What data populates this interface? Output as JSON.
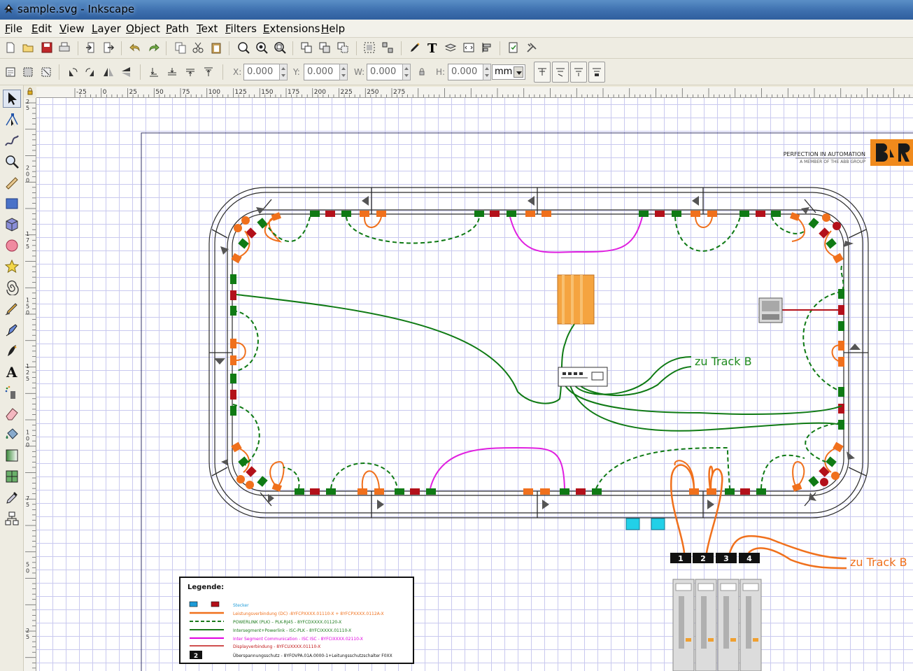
{
  "window": {
    "title": "sample.svg - Inkscape"
  },
  "menu": [
    "File",
    "Edit",
    "View",
    "Layer",
    "Object",
    "Path",
    "Text",
    "Filters",
    "Extensions",
    "Help"
  ],
  "controls": {
    "x_label": "X:",
    "x_value": "0.000",
    "y_label": "Y:",
    "y_value": "0.000",
    "w_label": "W:",
    "w_value": "0.000",
    "h_label": "H:",
    "h_value": "0.000",
    "unit": "mm"
  },
  "ruler": {
    "horizontal_ticks": [
      "-25",
      "0",
      "25",
      "50",
      "75",
      "100",
      "125",
      "150",
      "175",
      "200",
      "225",
      "250",
      "275"
    ],
    "vertical_ticks": [
      "25",
      "200",
      "175",
      "150",
      "125",
      "100",
      "75",
      "50",
      "25"
    ]
  },
  "drawing": {
    "logo_tagline": "PERFECTION IN AUTOMATION",
    "logo_subline": "A MEMBER OF THE ABB GROUP",
    "track_b_label_green": "zu Track B",
    "track_b_label_orange": "zu Track B",
    "connector_numbers": [
      "1",
      "2",
      "3",
      "4"
    ],
    "legend": {
      "title": "Legende:",
      "items": [
        {
          "label": "Stecker",
          "color": "#1e9bd7"
        },
        {
          "label": "Leistungsverbindung (DC) -8YFCPXXXX.01110-X + 8YFCPXXXX.0112A-X",
          "color": "#f07d1c"
        },
        {
          "label": "POWERLINK (PLK) – PLK-RJ45 - 8YFCDXXXX.01120-X",
          "color": "#1b7a1b"
        },
        {
          "label": "Intersegment+Powerlink - ISC-PLK - 8YFCIXXXX.01110-X",
          "color": "#1b7a1b"
        },
        {
          "label": "Inter Segment Communication - ISC ISC - 8YFCIXXXX.02110-X",
          "color": "#e000e0"
        },
        {
          "label": "Displayverbindung - 8YFCUXXXX.01110-X",
          "color": "#c01515"
        },
        {
          "label": "Überspannungsschutz - 8YFOVPA.01A.0000-1+Leitungsschutzschalter F0XX",
          "color": "#000000"
        }
      ],
      "badge_number": "2"
    }
  },
  "colors": {
    "green": "#0f7a14",
    "red": "#b3101a",
    "orange": "#f0701c",
    "magenta": "#e020e0",
    "track": "#2b2b2b"
  }
}
